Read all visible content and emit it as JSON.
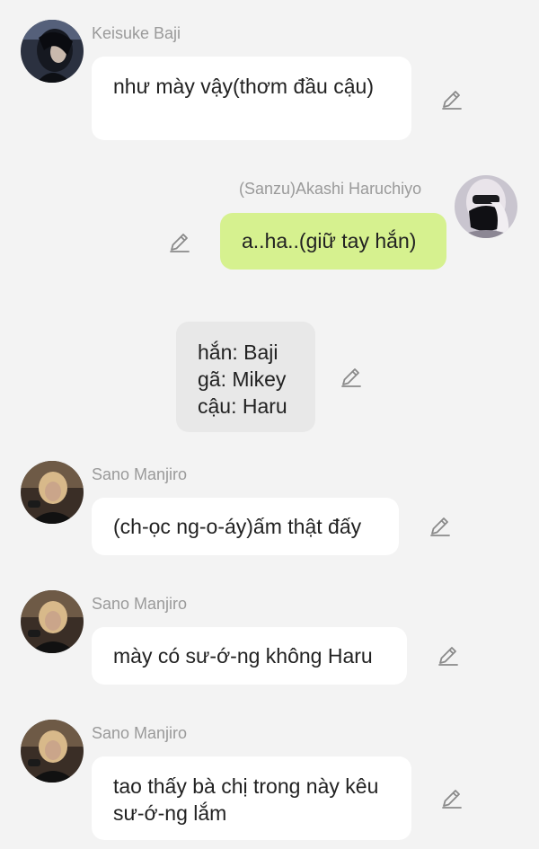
{
  "messages": [
    {
      "sender": "Keisuke Baji",
      "text": "như mày vậy(thơm đầu cậu)"
    },
    {
      "sender": "(Sanzu)Akashi Haruchiyo",
      "text": "a..ha..(giữ tay hắn)"
    },
    {
      "sender": "",
      "lines": [
        "hắn: Baji",
        "gã: Mikey",
        "cậu: Haru"
      ]
    },
    {
      "sender": "Sano Manjiro",
      "text": "(ch-ọc ng-o-áy)ấm thật đấy"
    },
    {
      "sender": "Sano Manjiro",
      "text": "mày có sư-ớ-ng không Haru"
    },
    {
      "sender": "Sano Manjiro",
      "text": "tao thấy bà chị trong này kêu sư-ớ-ng lắm"
    }
  ],
  "icons": {
    "edit": "pencil-edit-icon"
  },
  "colors": {
    "background": "#f3f3f3",
    "incoming_bubble": "#ffffff",
    "outgoing_bubble": "#d6f18f",
    "narration_bubble": "#e8e8e8",
    "sender_name": "#9a9a9a"
  }
}
